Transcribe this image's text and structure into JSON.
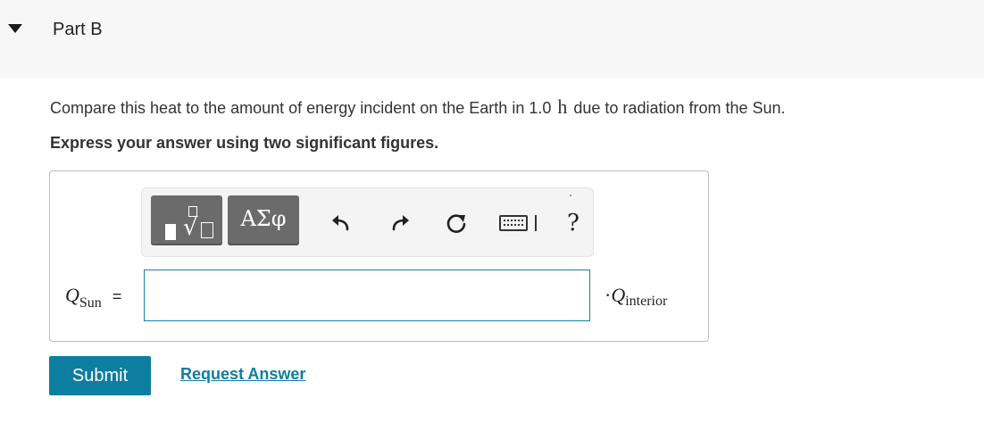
{
  "header": {
    "toggle_icon": "caret-down-icon",
    "title": "Part B"
  },
  "question": {
    "text_before": "Compare this heat to the amount of energy incident on the Earth in 1.0",
    "unit": "h",
    "text_after": "due to radiation from the Sun."
  },
  "instruction": "Express your answer using two significant figures.",
  "toolbar": {
    "templates_icon": "templates-icon",
    "greek_label": "ΑΣφ",
    "undo_icon": "undo-icon",
    "redo_icon": "redo-icon",
    "reset_icon": "reset-icon",
    "keyboard_icon": "keyboard-icon",
    "help_label": "?"
  },
  "answer": {
    "lhs_symbol": "Q",
    "lhs_subscript": "Sun",
    "equals": "=",
    "input_value": "",
    "rhs_prefix": "·",
    "rhs_symbol": "Q",
    "rhs_subscript": "interior"
  },
  "actions": {
    "submit_label": "Submit",
    "request_label": "Request Answer"
  },
  "colors": {
    "accent": "#0d7ea0",
    "header_bg": "#f7f7f7",
    "toolbar_button": "#6b6b6b"
  }
}
